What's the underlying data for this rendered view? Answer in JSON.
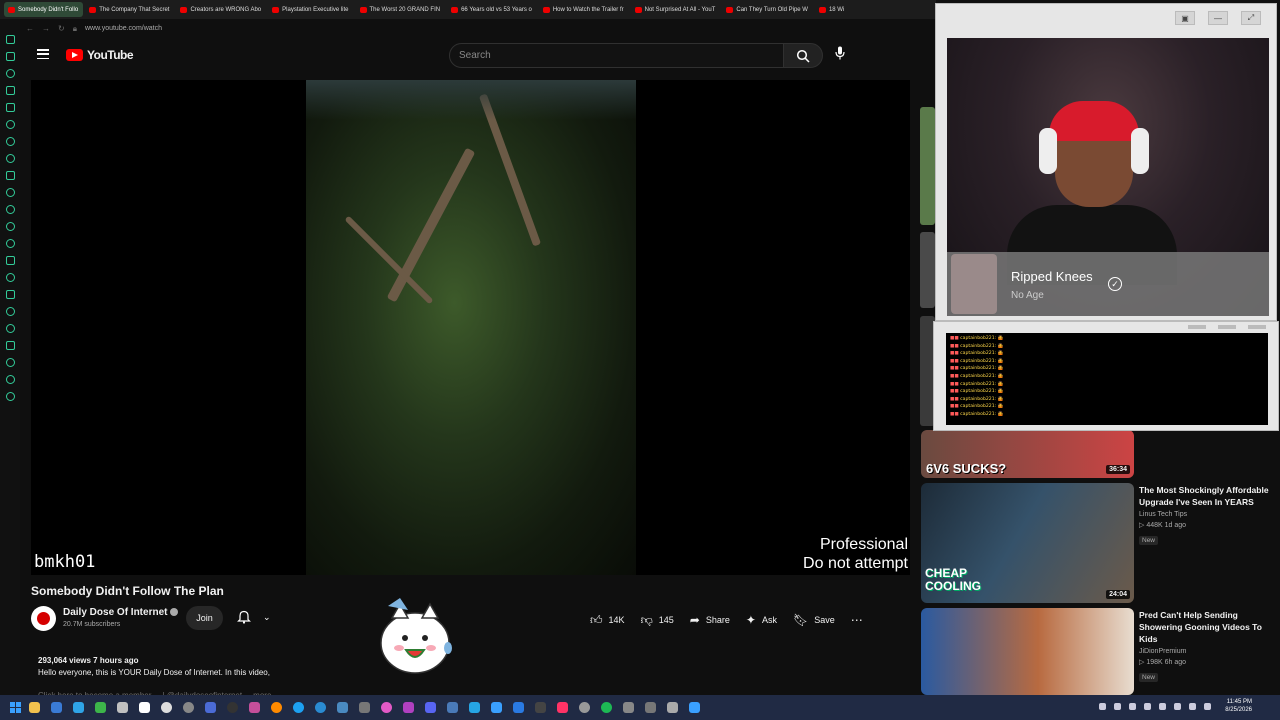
{
  "browser": {
    "tabs": [
      {
        "label": "Somebody Didn't Follo",
        "active": true
      },
      {
        "label": "The Company That Secret"
      },
      {
        "label": "Creators are WRONG Abo"
      },
      {
        "label": "Playstation Executive lite"
      },
      {
        "label": "The Worst 20 GRAND FIN"
      },
      {
        "label": "66 Years old vs 53 Years o"
      },
      {
        "label": "How to Watch the Trailer fr"
      },
      {
        "label": "Not Surprised At All - YouT"
      },
      {
        "label": "Can They Turn Old Pipe W"
      },
      {
        "label": "18 Wi"
      }
    ],
    "url": "www.youtube.com/watch"
  },
  "youtube": {
    "logo_text": "YouTube",
    "search_placeholder": "Search",
    "player": {
      "overlay_left": "bmkh01",
      "overlay_right_1": "Professional",
      "overlay_right_2": "Do not attempt"
    },
    "video": {
      "title": "Somebody Didn't Follow The Plan",
      "channel": "Daily Dose Of Internet",
      "subscribers": "20.7M subscribers",
      "join_label": "Join",
      "likes": "14K",
      "dislikes": "145",
      "share_label": "Share",
      "ask_label": "Ask",
      "save_label": "Save",
      "views_time": "293,064 views  7 hours ago",
      "description": "Hello everyone, this is YOUR Daily Dose of Internet. In this video,",
      "description_cut": "Click here to become a member ... | @dailydoseofinternet ... more"
    },
    "recommendations": [
      {
        "title": "",
        "duration": "36:34",
        "thumb_text": "6V6 SUCKS?",
        "thumb_color": "#3a2a2a"
      },
      {
        "title": "The Most Shockingly Affordable Upgrade I've Seen In YEARS",
        "channel": "Linus Tech Tips",
        "stats": "▷ 448K  1d ago",
        "badge": "New",
        "duration": "24:04",
        "thumb_text": "CHEAP COOLING",
        "thumb_color": "#20303a"
      },
      {
        "title": "Pred Can't Help Sending Showering Gooning Videos To Kids",
        "channel": "JiDionPremium",
        "stats": "▷ 198K  6h ago",
        "badge": "New",
        "duration": "",
        "thumb_text": "",
        "thumb_color": "#3b5a86"
      }
    ]
  },
  "webcam": {
    "name": "Ripped Knees",
    "status": "No Age"
  },
  "chat": {
    "lines": [
      "captainbob221:",
      "captainbob221:",
      "captainbob221:",
      "captainbob221:",
      "captainbob221:",
      "captainbob221:",
      "captainbob221:",
      "captainbob221:",
      "captainbob221:",
      "captainbob221:",
      "captainbob221:"
    ]
  },
  "taskbar": {
    "time": "11:45 PM",
    "date": "8/25/2026"
  },
  "colors": {
    "youtube_red": "#ff0000",
    "background": "#0f0f0f",
    "taskbar": "#202a44"
  }
}
